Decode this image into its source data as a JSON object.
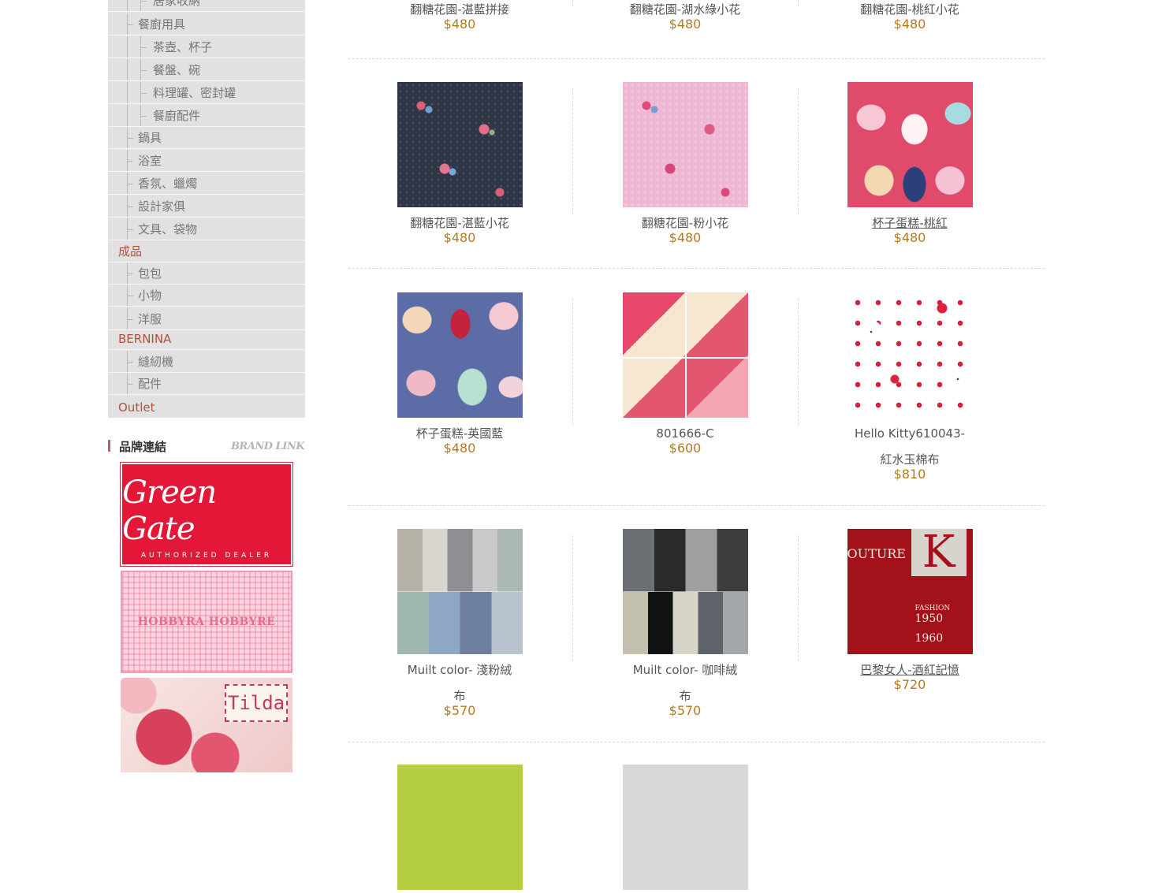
{
  "sidebar": {
    "categories": [
      {
        "level": 2,
        "label": "居家收納"
      },
      {
        "level": 1,
        "label": "餐廚用具"
      },
      {
        "level": 2,
        "label": "茶壺、杯子"
      },
      {
        "level": 2,
        "label": "餐盤、碗"
      },
      {
        "level": 2,
        "label": "料理罐、密封罐"
      },
      {
        "level": 2,
        "label": "餐廚配件"
      },
      {
        "level": 1,
        "label": "鍋具"
      },
      {
        "level": 1,
        "label": "浴室"
      },
      {
        "level": 1,
        "label": "香氛、蠟燭"
      },
      {
        "level": 1,
        "label": "設計家俱"
      },
      {
        "level": 1,
        "label": "文具、袋物"
      },
      {
        "level": 0,
        "label": "成品"
      },
      {
        "level": 1,
        "label": "包包"
      },
      {
        "level": 1,
        "label": "小物"
      },
      {
        "level": 1,
        "label": "洋服"
      },
      {
        "level": 0,
        "label": "BERNINA"
      },
      {
        "level": 1,
        "label": "縫紉機"
      },
      {
        "level": 1,
        "label": "配件"
      },
      {
        "level": 0,
        "label": "Outlet"
      }
    ],
    "brand_heading": "品牌連結",
    "brand_heading_en": "BRAND LINK",
    "brands": {
      "greengate": {
        "logo_text": "Green Gate",
        "sub": "AUTHORIZED DEALER"
      },
      "hobbyra": {
        "logo_text": "HOBBYRA HOBBYRE"
      },
      "tilda": {
        "logo_text": "Tilda"
      }
    }
  },
  "products": {
    "row0": [
      {
        "name": "翻糖花園-湛藍拼接",
        "price": "$480"
      },
      {
        "name": "翻糖花園-湖水綠小花",
        "price": "$480"
      },
      {
        "name": "翻糖花園-桃紅小花",
        "price": "$480"
      }
    ],
    "row1": [
      {
        "name": "翻糖花園-湛藍小花",
        "price": "$480",
        "swatch": "navy"
      },
      {
        "name": "翻糖花園-粉小花",
        "price": "$480",
        "swatch": "pink"
      },
      {
        "name": "杯子蛋糕-桃紅",
        "price": "$480",
        "swatch": "cupcake-red"
      }
    ],
    "row2": [
      {
        "name": "杯子蛋糕-英國藍",
        "price": "$480",
        "swatch": "cupcake-blue"
      },
      {
        "name": "801666-C",
        "price": "$600",
        "swatch": "patchwork"
      },
      {
        "name_line1": "Hello Kitty610043-",
        "name_line2": "紅水玉棉布",
        "price": "$810",
        "swatch": "kitty"
      }
    ],
    "row3": [
      {
        "name_line1": "Muilt color- 淺粉絨",
        "name_line2": "布",
        "price": "$570",
        "swatch": "multi-light"
      },
      {
        "name_line1": "Muilt color- 咖啡絨",
        "name_line2": "布",
        "price": "$570",
        "swatch": "multi-dark"
      },
      {
        "name": "巴黎女人-酒紅記憶",
        "price": "$720",
        "swatch": "paris",
        "image_text": {
          "word": "OUTURE",
          "letter": "K",
          "fashion": "FASHION",
          "year1": "1950",
          "year2": "1960"
        }
      }
    ]
  },
  "colors": {
    "price": "#b77a1b",
    "category_top": "#b0503f",
    "sidebar_bg": "#e1e1e1"
  }
}
